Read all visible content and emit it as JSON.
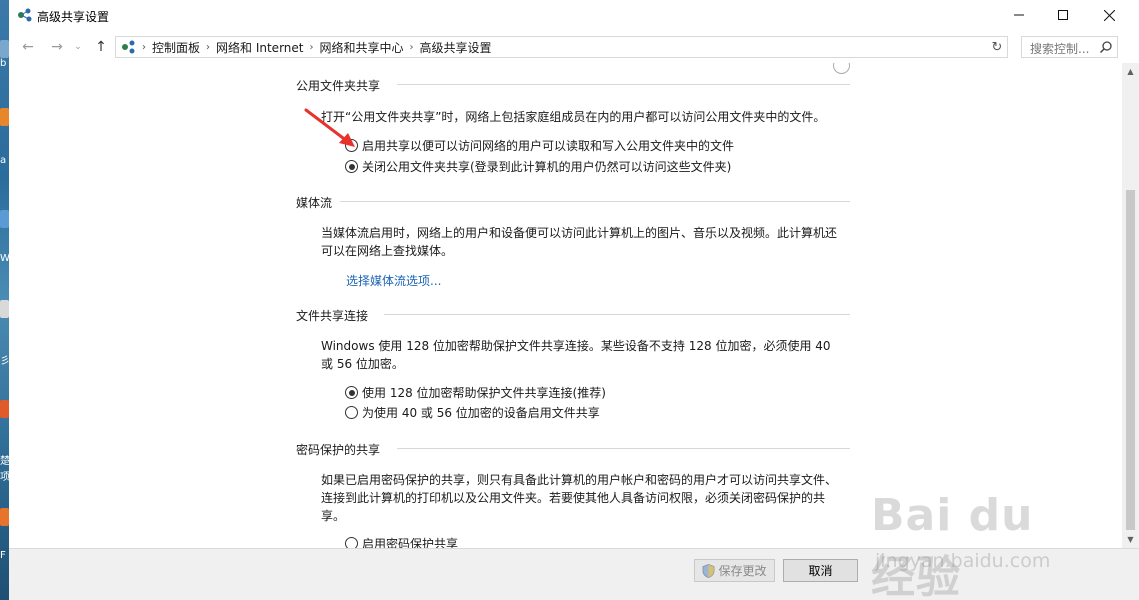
{
  "window": {
    "title": "高级共享设置"
  },
  "desktop": {
    "left_chars": [
      "b",
      "a",
      "W",
      "彡",
      "楚",
      "项",
      "F"
    ]
  },
  "address": {
    "crumbs": [
      "控制面板",
      "网络和 Internet",
      "网络和共享中心",
      "高级共享设置"
    ],
    "search_placeholder": "搜索控制..."
  },
  "sections": {
    "public_folder": {
      "title": "公用文件夹共享",
      "description": "打开“公用文件夹共享”时，网络上包括家庭组成员在内的用户都可以访问公用文件夹中的文件。",
      "option_on": "启用共享以便可以访问网络的用户可以读取和写入公用文件夹中的文件",
      "option_off": "关闭公用文件夹共享(登录到此计算机的用户仍然可以访问这些文件夹)",
      "selected": "off"
    },
    "media": {
      "title": "媒体流",
      "description": "当媒体流启用时，网络上的用户和设备便可以访问此计算机上的图片、音乐以及视频。此计算机还可以在网络上查找媒体。",
      "link": "选择媒体流选项..."
    },
    "file_sharing": {
      "title": "文件共享连接",
      "description": "Windows 使用 128 位加密帮助保护文件共享连接。某些设备不支持 128 位加密，必须使用 40 或 56 位加密。",
      "option_128": "使用 128 位加密帮助保护文件共享连接(推荐)",
      "option_40_56": "为使用 40 或 56 位加密的设备启用文件共享",
      "selected": "128"
    },
    "password": {
      "title": "密码保护的共享",
      "description": "如果已启用密码保护的共享，则只有具备此计算机的用户帐户和密码的用户才可以访问共享文件、连接到此计算机的打印机以及公用文件夹。若要使其他人具备访问权限，必须关闭密码保护的共享。",
      "option_on": "启用密码保护共享"
    }
  },
  "footer": {
    "save_label": "保存更改",
    "cancel_label": "取消"
  },
  "watermark": {
    "brand": "Bai du 经验",
    "sub": "jingyan.baidu.com"
  },
  "colors": {
    "link": "#1c64b4",
    "arrow": "#e8322c"
  }
}
